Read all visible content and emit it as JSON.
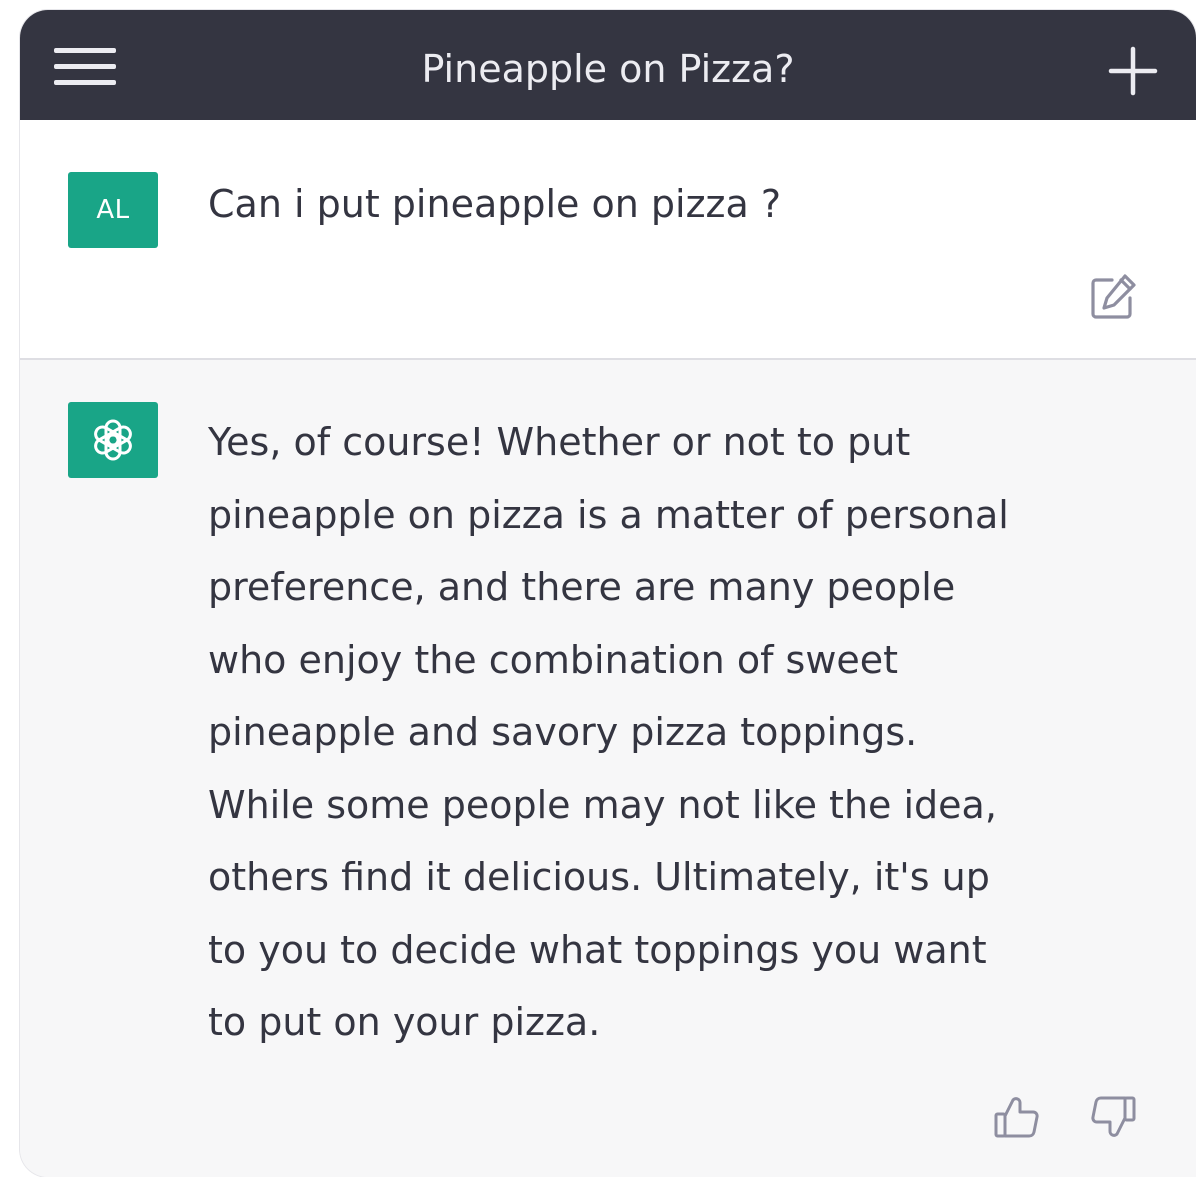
{
  "header": {
    "title": "Pineapple on Pizza?",
    "menu_icon": "hamburger-menu-icon",
    "new_chat_icon": "plus-icon"
  },
  "user_message": {
    "avatar_initials": "AL",
    "text": "Can i put pineapple on pizza ?",
    "edit_icon": "edit-icon"
  },
  "assistant_message": {
    "avatar_icon": "openai-logo-icon",
    "lines": [
      "Yes, of course! Whether or not to put",
      "pineapple on pizza is a matter of personal",
      "preference, and there are many people",
      "who enjoy the combination of sweet",
      "pineapple and savory pizza toppings.",
      "While some people may not like the idea,",
      "others find it delicious. Ultimately, it's up",
      "to you to decide what toppings you want",
      "to put on your pizza."
    ],
    "thumbs_up_icon": "thumbs-up-icon",
    "thumbs_down_icon": "thumbs-down-icon"
  },
  "colors": {
    "header_bg": "#343541",
    "accent": "#19a587",
    "text": "#343541",
    "assistant_bg": "#f7f7f8"
  }
}
